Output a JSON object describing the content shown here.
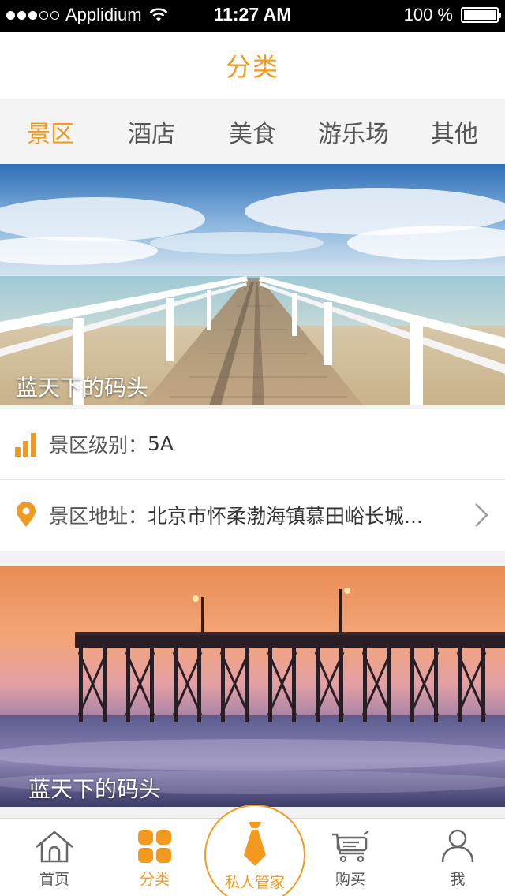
{
  "status_bar": {
    "carrier": "Applidium",
    "time": "11:27 AM",
    "battery": "100 %"
  },
  "nav": {
    "title": "分类"
  },
  "tabs": [
    {
      "label": "景区",
      "active": true
    },
    {
      "label": "酒店",
      "active": false
    },
    {
      "label": "美食",
      "active": false
    },
    {
      "label": "游乐场",
      "active": false
    },
    {
      "label": "其他",
      "active": false
    }
  ],
  "cards": [
    {
      "caption": "蓝天下的码头",
      "level_label": "景区级别：",
      "level_value": "5A",
      "address_label": "景区地址：",
      "address_value": "北京市怀柔渤海镇慕田峪长城..."
    },
    {
      "caption": "蓝天下的码头"
    }
  ],
  "tabbar": {
    "home": "首页",
    "category": "分类",
    "butler": "私人管家",
    "buy": "购买",
    "me": "我"
  },
  "colors": {
    "accent": "#f39a1e"
  }
}
